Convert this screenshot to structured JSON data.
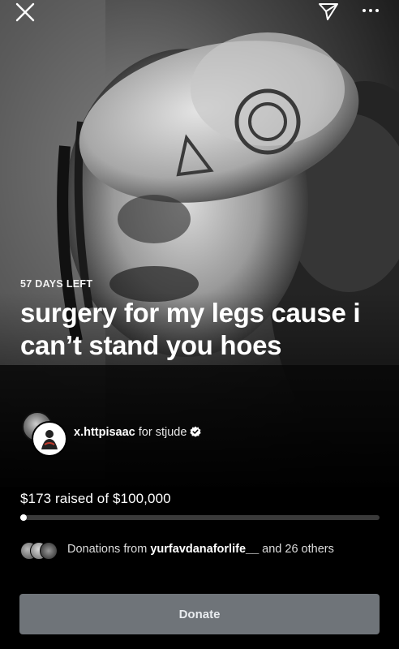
{
  "campaign": {
    "days_left": "57 DAYS LEFT",
    "title": "surgery for my legs cause i can’t stand you hoes"
  },
  "organizer": {
    "username": "x.httpisaac",
    "for_text": "for",
    "charity": "stjude",
    "verified": true
  },
  "progress": {
    "raised_text": "$173 raised of $100,000",
    "raised": 173,
    "goal": 100000
  },
  "donations": {
    "prefix": "Donations from",
    "donor": "yurfavdanaforlife__",
    "suffix": "and 26 others"
  },
  "donate_button": {
    "label": "Donate"
  },
  "icons": {
    "close": "close-icon",
    "share": "paper-plane-icon",
    "more": "more-horizontal-icon"
  },
  "colors": {
    "background": "#000000",
    "button": "#6f7479",
    "track": "#3a3a3a",
    "verified": "#ffffff"
  }
}
